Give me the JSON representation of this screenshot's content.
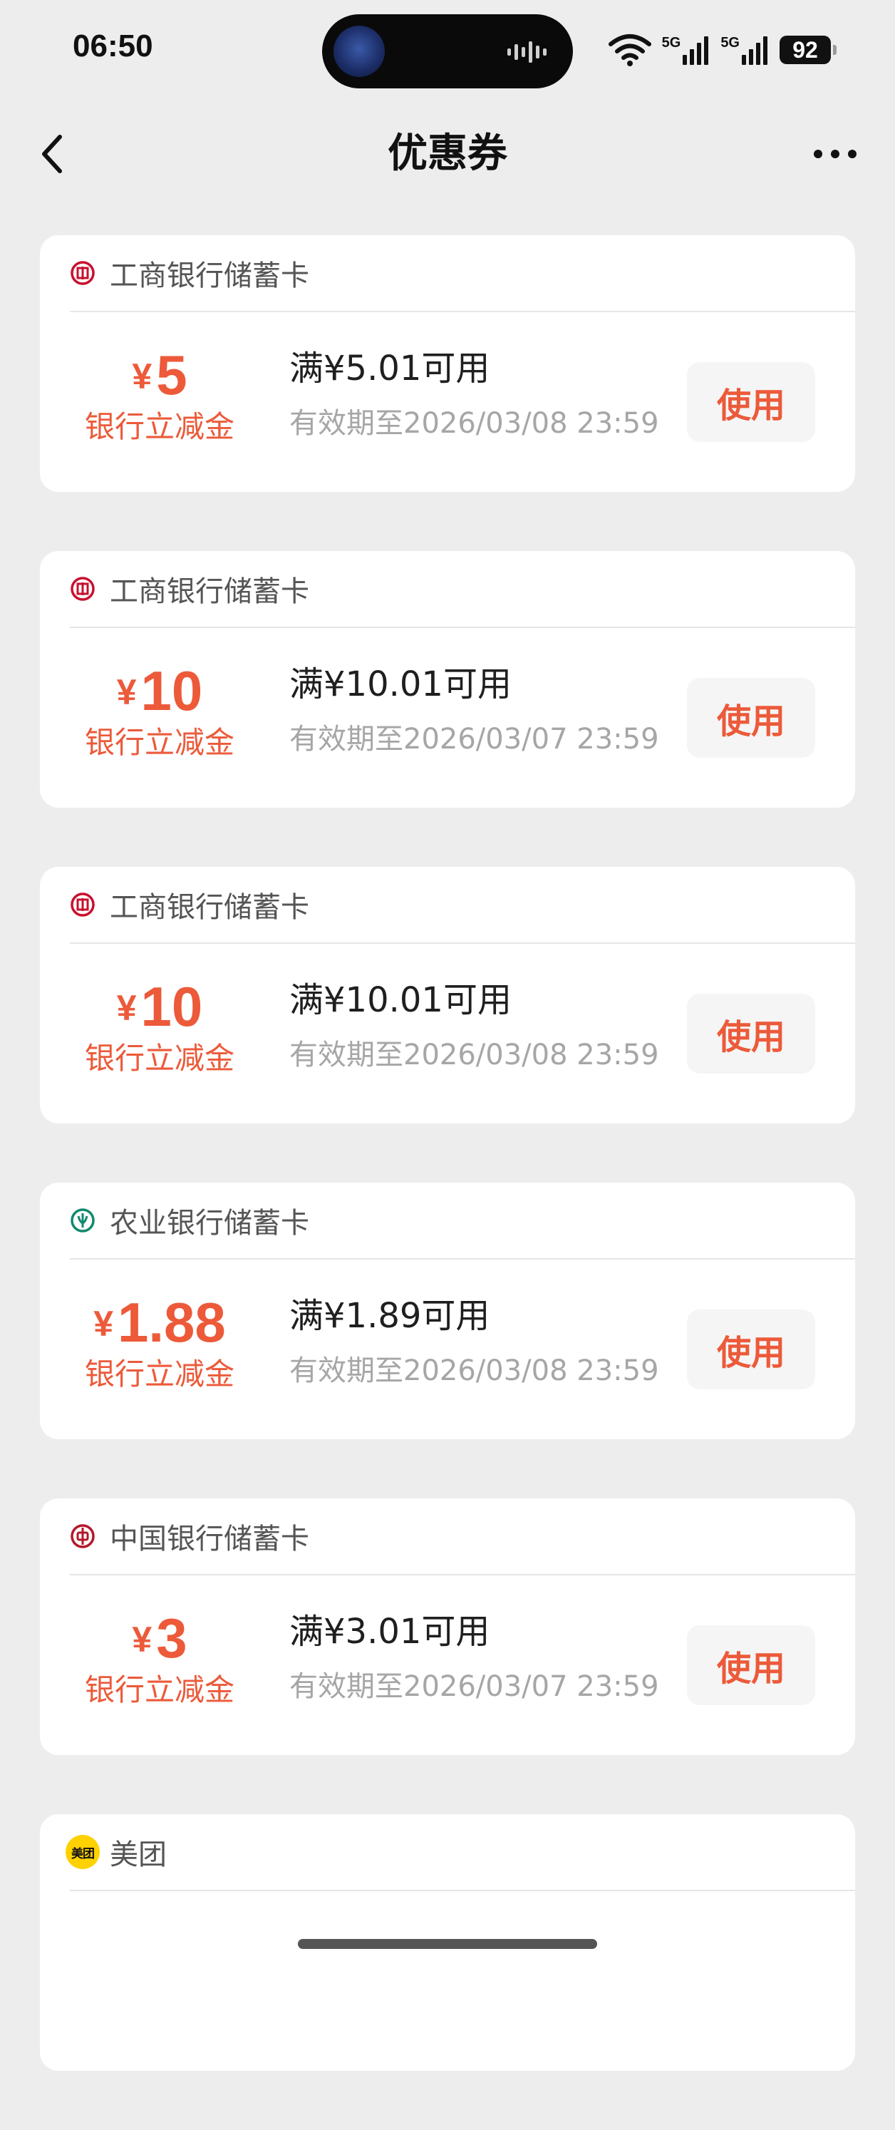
{
  "status_bar": {
    "time": "06:50",
    "network_1": "5G",
    "network_2": "5G",
    "battery": "92",
    "icons": [
      "wifi-icon",
      "signal-5g-icon",
      "signal-5g-icon",
      "battery-icon"
    ]
  },
  "nav": {
    "title": "优惠券",
    "back_icon": "chevron-left-icon",
    "more_icon": "more-dots-icon"
  },
  "colors": {
    "accent": "#ec5a3a",
    "background": "#ededed",
    "card": "#ffffff",
    "icbc_red": "#c8102e",
    "abc_green": "#0f8a6e",
    "boc_red": "#b5172b",
    "meituan_yellow": "#ffd100"
  },
  "coupons": [
    {
      "bank": "工商银行储蓄卡",
      "logo": "icbc-logo-icon",
      "currency": "¥",
      "amount": "5",
      "type": "银行立减金",
      "threshold": "满¥5.01可用",
      "validity": "有效期至2026/03/08 23:59",
      "action": "使用"
    },
    {
      "bank": "工商银行储蓄卡",
      "logo": "icbc-logo-icon",
      "currency": "¥",
      "amount": "10",
      "type": "银行立减金",
      "threshold": "满¥10.01可用",
      "validity": "有效期至2026/03/07 23:59",
      "action": "使用"
    },
    {
      "bank": "工商银行储蓄卡",
      "logo": "icbc-logo-icon",
      "currency": "¥",
      "amount": "10",
      "type": "银行立减金",
      "threshold": "满¥10.01可用",
      "validity": "有效期至2026/03/08 23:59",
      "action": "使用"
    },
    {
      "bank": "农业银行储蓄卡",
      "logo": "abc-logo-icon",
      "currency": "¥",
      "amount": "1.88",
      "type": "银行立减金",
      "threshold": "满¥1.89可用",
      "validity": "有效期至2026/03/08 23:59",
      "action": "使用"
    },
    {
      "bank": "中国银行储蓄卡",
      "logo": "boc-logo-icon",
      "currency": "¥",
      "amount": "3",
      "type": "银行立减金",
      "threshold": "满¥3.01可用",
      "validity": "有效期至2026/03/07 23:59",
      "action": "使用"
    },
    {
      "bank": "美团",
      "logo": "meituan-logo-icon",
      "logo_text": "美团"
    }
  ]
}
